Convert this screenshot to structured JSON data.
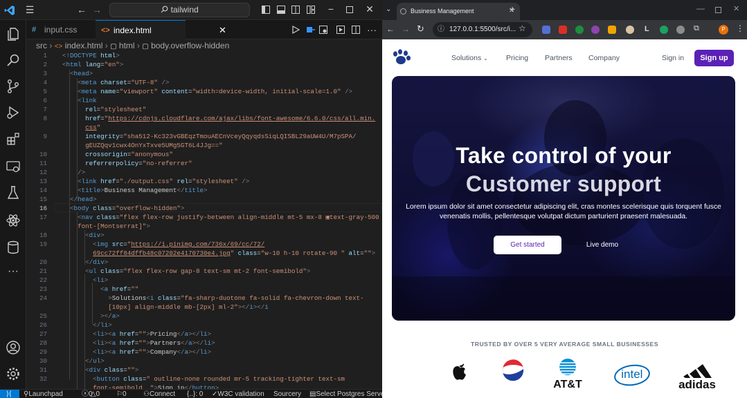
{
  "vscode": {
    "search": "tailwind",
    "tabs": [
      {
        "icon": "#",
        "label": "input.css"
      },
      {
        "icon": "<>",
        "label": "index.html"
      }
    ],
    "breadcrumb": [
      "src",
      "index.html",
      "html",
      "body.overflow-hidden"
    ],
    "line_numbers": [
      "1",
      "2",
      "3",
      "4",
      "5",
      "6",
      "7",
      "8",
      "",
      "9",
      "",
      "10",
      "11",
      "12",
      "13",
      "14",
      "15",
      "16",
      "17",
      "",
      "18",
      "19",
      "",
      "20",
      "21",
      "22",
      "23",
      "24",
      "",
      "25",
      "26",
      "27",
      "28",
      "29",
      "30",
      "31",
      "32",
      ""
    ],
    "status": {
      "launchpad": "Launchpad",
      "problems": "0",
      "warnings": "0",
      "ports": "0",
      "connect": "Connect",
      "json": "{..}: 0",
      "w3c": "W3C validation",
      "sourcery": "Sourcery",
      "postgres": "Select Postgres Server"
    }
  },
  "browser": {
    "tab_title": "Business Management",
    "url": "127.0.0.1:5500/src/i..."
  },
  "site": {
    "nav": {
      "solutions": "Solutions",
      "pricing": "Pricing",
      "partners": "Partners",
      "company": "Company",
      "signin": "Sign in",
      "signup": "Sign up"
    },
    "hero": {
      "line1": "Take control of your",
      "line2": "Customer support",
      "text": "Lorem ipsum dolor sit amet consectetur adipiscing elit, cras montes scelerisque quis torquent fusce venenatis mollis, pellentesque volutpat dictum parturient praesent malesuada.",
      "cta_primary": "Get started",
      "cta_secondary": "Live demo"
    },
    "trusted": "TRUSTED BY OVER 5 VERY AVERAGE SMALL BUSINESSES",
    "logos": {
      "att": "AT&T",
      "intel": "intel",
      "adidas": "adidas"
    }
  },
  "colors": {
    "accent": "#5b21b6",
    "vscode_blue": "#0078d4"
  }
}
